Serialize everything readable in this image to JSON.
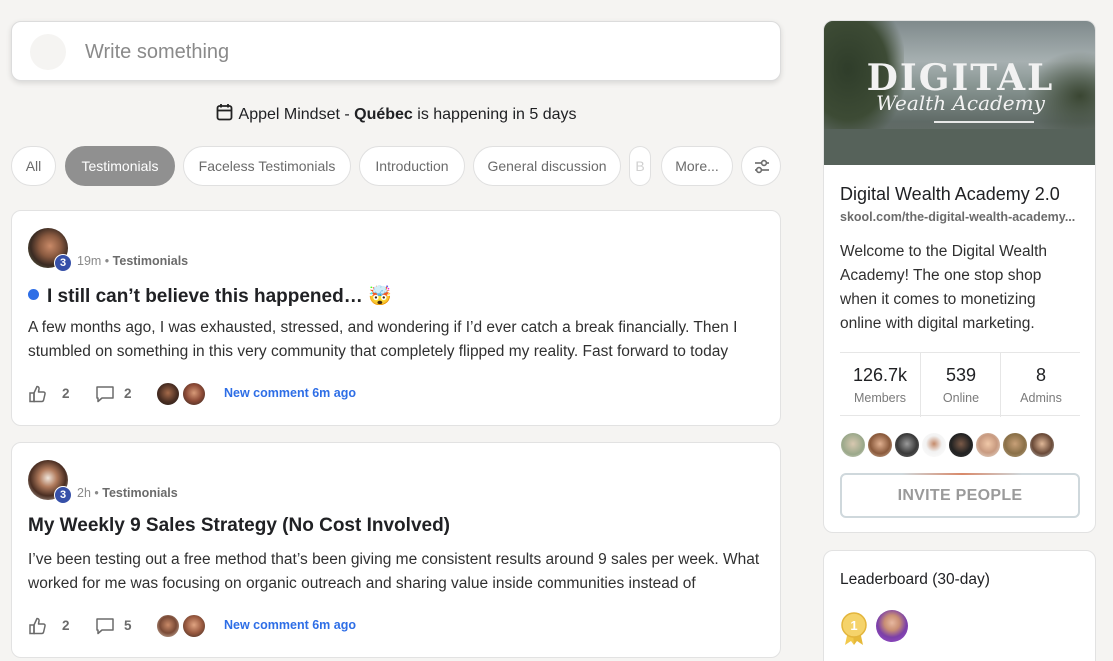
{
  "composer": {
    "placeholder": "Write something"
  },
  "event": {
    "name": "Appel Mindset",
    "sep": " - ",
    "place": "Québec",
    "suffix": " is happening in 5 days"
  },
  "filters": {
    "chips": [
      "All",
      "Testimonials",
      "Faceless Testimonials",
      "Introduction",
      "General discussion",
      "B",
      "More..."
    ],
    "active": "Testimonials"
  },
  "posts": [
    {
      "level": "3",
      "time": "19m",
      "category": "Testimonials",
      "title": "I still can’t believe this happened…",
      "emoji": "🤯",
      "unread": true,
      "body": "A few months ago, I was exhausted, stressed, and wondering if I’d ever catch a break financially. Then I stumbled on something in this very community that completely flipped my reality. Fast forward to today",
      "likes": "2",
      "comments": "2",
      "new_comment": "New comment 6m ago"
    },
    {
      "level": "3",
      "time": "2h",
      "category": "Testimonials",
      "title": "My Weekly 9 Sales Strategy (No Cost Involved)",
      "unread": false,
      "body": "I’ve been testing out a free method that’s been giving me consistent results around 9 sales per week. What worked for me was focusing on organic outreach and sharing value inside communities instead of",
      "likes": "2",
      "comments": "5",
      "new_comment": "New comment 6m ago"
    }
  ],
  "group": {
    "cover_line1": "DIGITAL",
    "cover_line2": "Wealth Academy",
    "name": "Digital Wealth Academy 2.0",
    "url": "skool.com/the-digital-wealth-academy...",
    "description": "Welcome to the Digital Wealth Academy! The one stop shop when it comes to monetizing online with digital marketing.",
    "stats": [
      {
        "value": "126.7k",
        "label": "Members"
      },
      {
        "value": "539",
        "label": "Online"
      },
      {
        "value": "8",
        "label": "Admins"
      }
    ],
    "invite_label": "INVITE PEOPLE"
  },
  "leaderboard": {
    "title": "Leaderboard (30-day)",
    "rank": "1"
  },
  "colors": {
    "accent": "#2e6ee6",
    "level_badge": "#3650a8",
    "chip_active": "#909090",
    "gold": "#f2c94c"
  }
}
